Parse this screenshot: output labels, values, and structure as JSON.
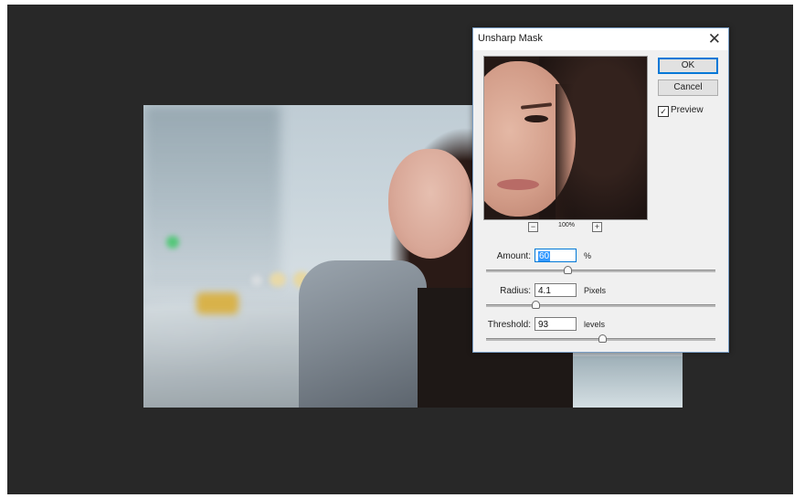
{
  "dialog": {
    "title": "Unsharp Mask",
    "close_symbol": "✕",
    "ok_label": "OK",
    "cancel_label": "Cancel",
    "preview_label": "Preview",
    "preview_checked": true,
    "checkmark": "✓",
    "zoom_level": "100%",
    "zoom_out_symbol": "−",
    "zoom_in_symbol": "+",
    "params": [
      {
        "label": "Amount:",
        "value": "60",
        "unit": "%",
        "slider_fraction": 0.35
      },
      {
        "label": "Radius:",
        "value": "4.1",
        "unit": "Pixels",
        "slider_fraction": 0.21
      },
      {
        "label": "Threshold:",
        "value": "93",
        "unit": "levels",
        "slider_fraction": 0.5
      }
    ]
  },
  "icons": {
    "close": "close-icon",
    "zoom_out": "zoom-out-icon",
    "zoom_in": "zoom-in-icon",
    "checkbox": "checkmark-icon"
  },
  "colors": {
    "workspace_bg": "#282828",
    "selection": "#3399ff",
    "focus_border": "#0078d7"
  }
}
